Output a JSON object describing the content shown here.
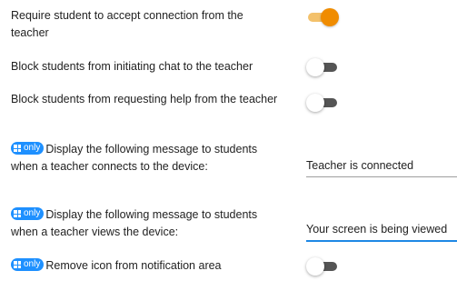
{
  "settings": {
    "require_accept": {
      "label": "Require student to accept connection from the teacher",
      "enabled": true
    },
    "block_chat": {
      "label": "Block students from initiating chat to the teacher",
      "enabled": false
    },
    "block_help": {
      "label": "Block students from requesting help from the teacher",
      "enabled": false
    },
    "connect_message": {
      "badge": "only",
      "label": "Display the following message to students when a teacher connects to the device:",
      "value": "Teacher is connected"
    },
    "view_message": {
      "badge": "only",
      "label": "Display the following message to students when a teacher views the device:",
      "value": "Your screen is being viewed"
    },
    "remove_icon": {
      "badge": "only",
      "label": "Remove icon from notification area",
      "enabled": false
    }
  },
  "colors": {
    "toggle_on_thumb": "#f08c00",
    "toggle_on_track": "#f3c16b",
    "toggle_off_track": "#555555",
    "badge": "#1e90ff",
    "focus_underline": "#1e88e5"
  },
  "icons": {
    "badge_icon": "windows-logo-icon"
  }
}
